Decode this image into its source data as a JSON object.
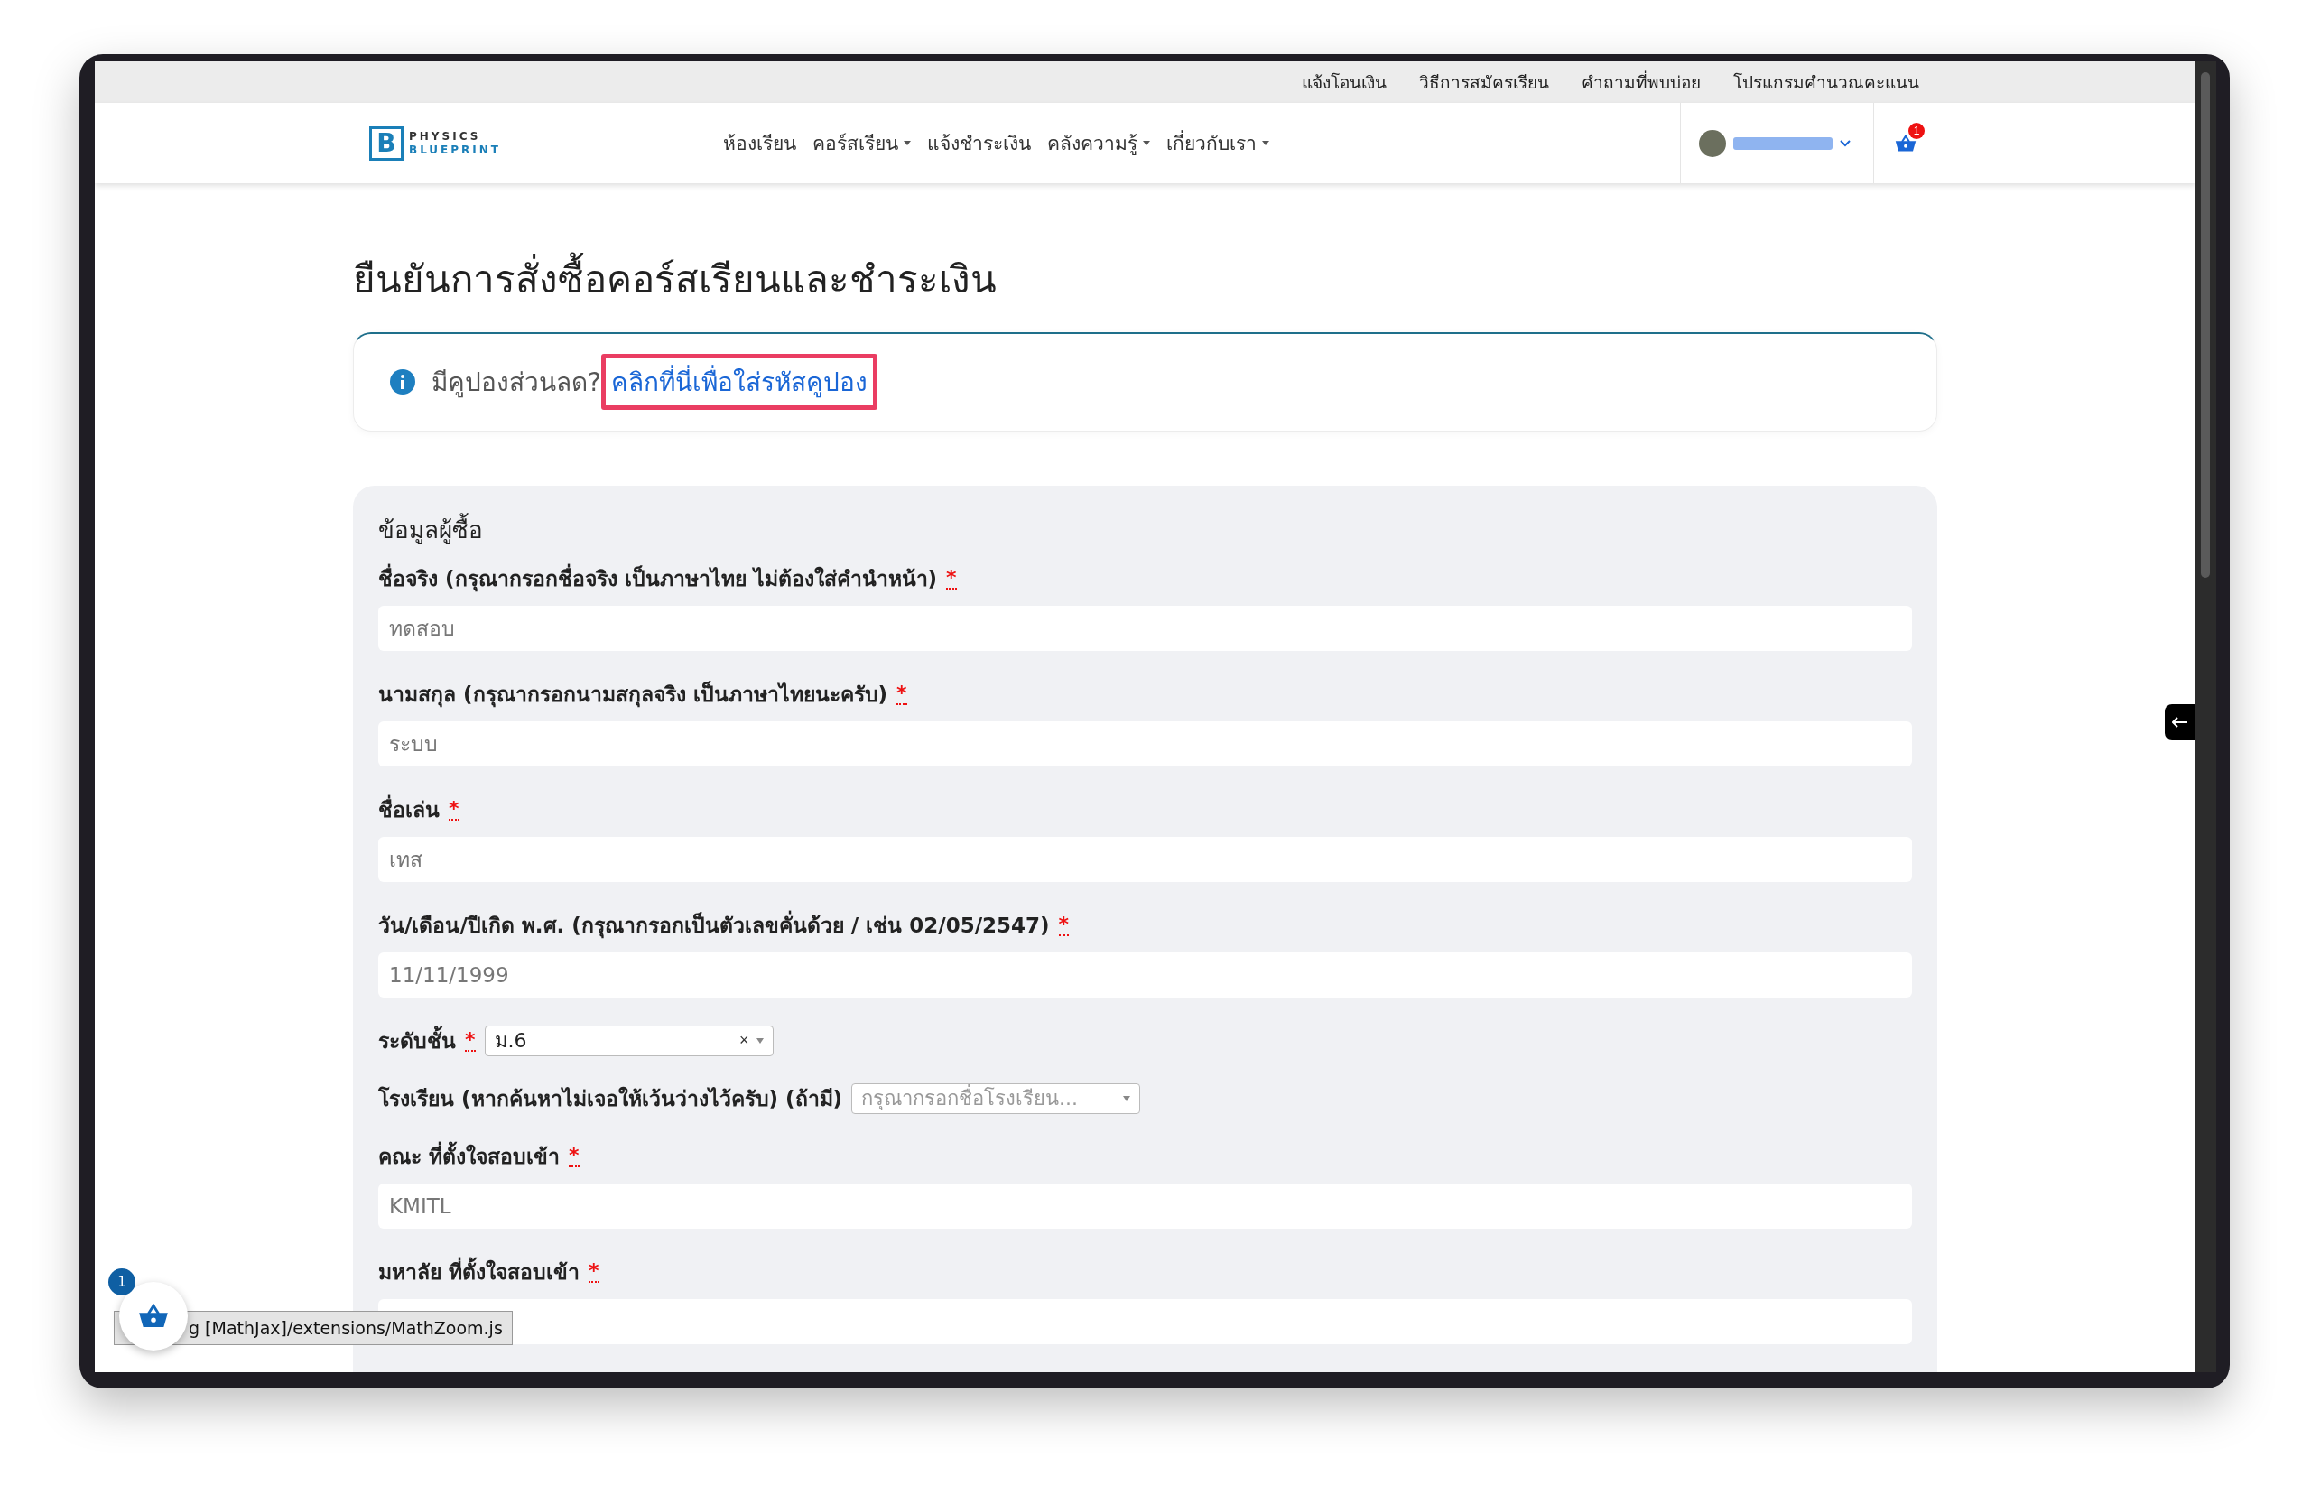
{
  "top_links": [
    "แจ้งโอนเงิน",
    "วิธีการสมัครเรียน",
    "คำถามที่พบบ่อย",
    "โปรแกรมคำนวณคะแนน"
  ],
  "logo": {
    "mark": "B",
    "line_1": "PHYSICS",
    "line_2": "BLUEPRINT"
  },
  "nav": [
    {
      "label": "ห้องเรียน",
      "has_menu": false
    },
    {
      "label": "คอร์สเรียน",
      "has_menu": true
    },
    {
      "label": "แจ้งชำระเงิน",
      "has_menu": false
    },
    {
      "label": "คลังความรู้",
      "has_menu": true
    },
    {
      "label": "เกี่ยวกับเรา",
      "has_menu": true
    }
  ],
  "cart": {
    "count": "1"
  },
  "page_title": "ยืนยันการสั่งซื้อคอร์สเรียนและชำระเงิน",
  "coupon": {
    "prompt": "มีคูปองส่วนลด?",
    "link": "คลิกที่นี่เพื่อใส่รหัสคูปอง",
    "highlighted": true
  },
  "form": {
    "section_title": "ข้อมูลผู้ซื้อ",
    "required_mark": "*",
    "fields": [
      {
        "kind": "text",
        "label": "ชื่อจริง (กรุณากรอกชื่อจริง เป็นภาษาไทย ไม่ต้องใส่คำนำหน้า)",
        "required": true,
        "value": "ทดสอบ"
      },
      {
        "kind": "text",
        "label": "นามสกุล (กรุณากรอกนามสกุลจริง เป็นภาษาไทยนะครับ)",
        "required": true,
        "value": "ระบบ"
      },
      {
        "kind": "text",
        "label": "ชื่อเล่น",
        "required": true,
        "value": "เทส"
      },
      {
        "kind": "text",
        "label": "วัน/เดือน/ปีเกิด พ.ศ. (กรุณากรอกเป็นตัวเลขคั่นด้วย / เช่น 02/05/2547)",
        "required": true,
        "value": "11/11/1999"
      },
      {
        "kind": "select",
        "label": "ระดับชั้น",
        "required": true,
        "value": "ม.6",
        "clear": "×"
      },
      {
        "kind": "select",
        "label": "โรงเรียน (หากค้นหาไม่เจอให้เว้นว่างไว้ครับ) (ถ้ามี)",
        "required": false,
        "placeholder": "กรุณากรอกชื่อโรงเรียน..."
      },
      {
        "kind": "text",
        "label": "คณะ ที่ตั้งใจสอบเข้า",
        "required": true,
        "value": "KMITL"
      },
      {
        "kind": "text",
        "label": "มหาลัย ที่ตั้งใจสอบเข้า",
        "required": true
      }
    ]
  },
  "floating_cart": {
    "count": "1"
  },
  "status_tooltip": "g [MathJax]/extensions/MathZoom.js"
}
